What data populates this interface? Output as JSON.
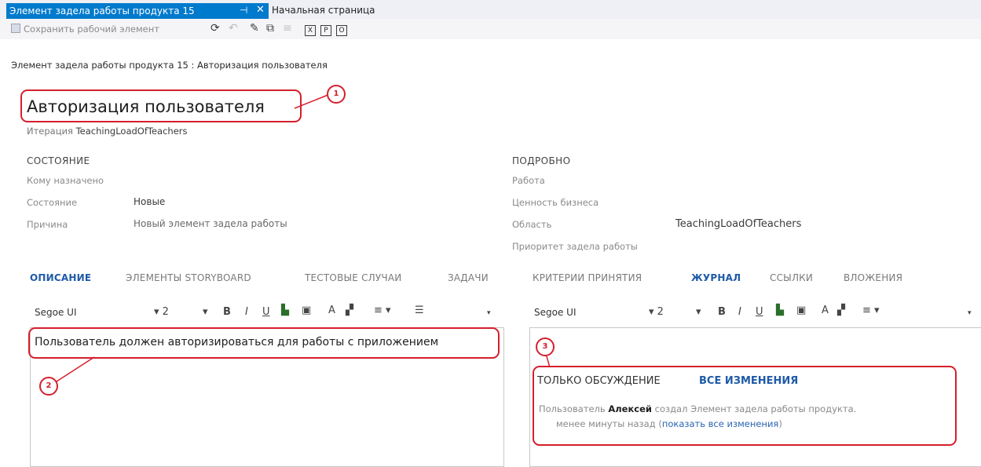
{
  "tabs": {
    "active_label": "Элемент задела работы продукта 15",
    "pin_glyph": "⊣",
    "close_glyph": "✕",
    "inactive_label": "Начальная страница"
  },
  "toolbar": {
    "save_label": "Сохранить рабочий элемент",
    "icons": [
      "refresh-icon",
      "undo-icon",
      "clean-icon",
      "copy-icon",
      "link-icon",
      "excel-icon",
      "project-icon",
      "outlook-icon"
    ],
    "box1": "X",
    "box2": "P",
    "box3": "O"
  },
  "breadcrumb": "Элемент задела работы продукта 15 : Авторизация пользователя",
  "title": "Авторизация пользователя",
  "iteration": {
    "label": "Итерация",
    "value": "TeachingLoadOfTeachers"
  },
  "state_section": {
    "header": "СОСТОЯНИЕ",
    "assigned_label": "Кому назначено",
    "state_label": "Состояние",
    "state_value": "Новые",
    "reason_label": "Причина",
    "reason_value": "Новый элемент задела работы"
  },
  "details_section": {
    "header": "ПОДРОБНО",
    "work_label": "Работа",
    "business_label": "Ценность бизнеса",
    "area_label": "Область",
    "area_value": "TeachingLoadOfTeachers",
    "priority_label": "Приоритет задела работы"
  },
  "left_tabs": [
    "ОПИСАНИЕ",
    "ЭЛЕМЕНТЫ STORYBOARD",
    "ТЕСТОВЫЕ СЛУЧАИ",
    "ЗАДАЧИ"
  ],
  "right_tabs": [
    "КРИТЕРИИ ПРИНЯТИЯ",
    "ЖУРНАЛ",
    "ССЫЛКИ",
    "ВЛОЖЕНИЯ"
  ],
  "editor_toolbar": {
    "font": "Segoe UI",
    "size": "2",
    "bold": "B",
    "italic": "I",
    "underline": "U"
  },
  "description_text": "Пользователь должен авторизироваться для работы с приложением",
  "history": {
    "filter_discussion": "ТОЛЬКО ОБСУЖДЕНИЕ",
    "filter_all": "ВСЕ ИЗМЕНЕНИЯ",
    "entry_prefix": "Пользователь",
    "entry_user": "Алексей",
    "entry_action": "создал Элемент задела работы продукта.",
    "entry_time": "менее минуты назад (",
    "entry_link": "показать все изменения",
    "entry_close": ")"
  },
  "annotations": {
    "m1": "1",
    "m2": "2",
    "m3": "3"
  },
  "colors": {
    "accent_tab": "#007acc",
    "active_tab_text": "#1e5aa8",
    "annotation_red": "#d61f2c",
    "link": "#2b64b3"
  }
}
